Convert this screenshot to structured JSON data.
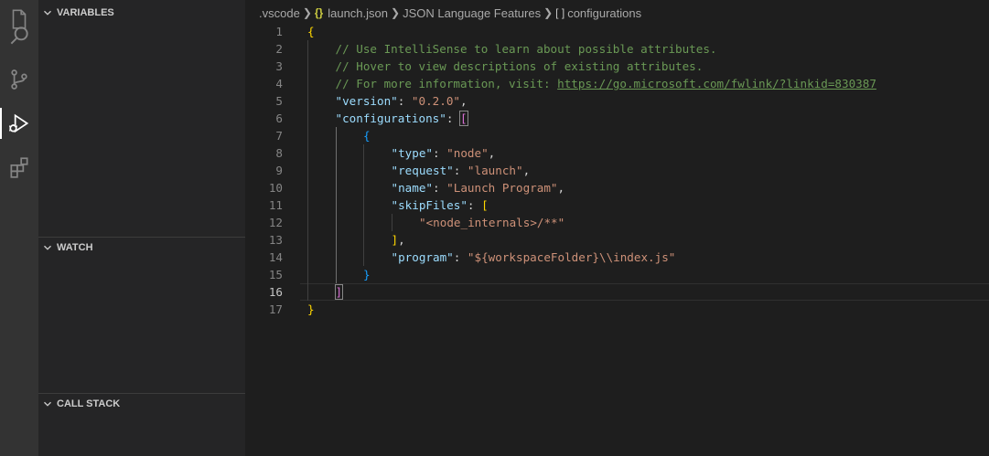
{
  "activity_bar": {
    "items": [
      {
        "icon": "explorer-icon"
      },
      {
        "icon": "search-icon"
      },
      {
        "icon": "source-control-icon"
      },
      {
        "icon": "run-debug-icon",
        "active": true
      },
      {
        "icon": "extensions-icon"
      }
    ]
  },
  "sidebar": {
    "variables_label": "VARIABLES",
    "watch_label": "WATCH",
    "call_stack_label": "CALL STACK"
  },
  "breadcrumb": {
    "folder": ".vscode",
    "file_icon": "{}",
    "file": "launch.json",
    "section": "JSON Language Features",
    "symbol_icon": "[ ]",
    "symbol": "configurations"
  },
  "editor": {
    "current_line": 16,
    "lines": [
      {
        "num": "1",
        "indent": 0,
        "tokens": [
          {
            "t": "{",
            "c": "c-brace1"
          }
        ]
      },
      {
        "num": "2",
        "indent": 1,
        "tokens": [
          {
            "t": "// Use IntelliSense to learn about possible attributes.",
            "c": "c-comment"
          }
        ]
      },
      {
        "num": "3",
        "indent": 1,
        "tokens": [
          {
            "t": "// Hover to view descriptions of existing attributes.",
            "c": "c-comment"
          }
        ]
      },
      {
        "num": "4",
        "indent": 1,
        "tokens": [
          {
            "t": "// For more information, visit: ",
            "c": "c-comment"
          },
          {
            "t": "https://go.microsoft.com/fwlink/?linkid=830387",
            "c": "c-link"
          }
        ]
      },
      {
        "num": "5",
        "indent": 1,
        "tokens": [
          {
            "t": "\"version\"",
            "c": "c-key"
          },
          {
            "t": ": ",
            "c": "c-punc"
          },
          {
            "t": "\"0.2.0\"",
            "c": "c-str"
          },
          {
            "t": ",",
            "c": "c-punc"
          }
        ]
      },
      {
        "num": "6",
        "indent": 1,
        "tokens": [
          {
            "t": "\"configurations\"",
            "c": "c-key"
          },
          {
            "t": ": ",
            "c": "c-punc"
          },
          {
            "t": "[",
            "c": "c-brace2 bracket-match"
          }
        ]
      },
      {
        "num": "7",
        "indent": 2,
        "tokens": [
          {
            "t": "{",
            "c": "c-brace3"
          }
        ]
      },
      {
        "num": "8",
        "indent": 3,
        "tokens": [
          {
            "t": "\"type\"",
            "c": "c-key"
          },
          {
            "t": ": ",
            "c": "c-punc"
          },
          {
            "t": "\"node\"",
            "c": "c-str"
          },
          {
            "t": ",",
            "c": "c-punc"
          }
        ]
      },
      {
        "num": "9",
        "indent": 3,
        "tokens": [
          {
            "t": "\"request\"",
            "c": "c-key"
          },
          {
            "t": ": ",
            "c": "c-punc"
          },
          {
            "t": "\"launch\"",
            "c": "c-str"
          },
          {
            "t": ",",
            "c": "c-punc"
          }
        ]
      },
      {
        "num": "10",
        "indent": 3,
        "tokens": [
          {
            "t": "\"name\"",
            "c": "c-key"
          },
          {
            "t": ": ",
            "c": "c-punc"
          },
          {
            "t": "\"Launch Program\"",
            "c": "c-str"
          },
          {
            "t": ",",
            "c": "c-punc"
          }
        ]
      },
      {
        "num": "11",
        "indent": 3,
        "tokens": [
          {
            "t": "\"skipFiles\"",
            "c": "c-key"
          },
          {
            "t": ": ",
            "c": "c-punc"
          },
          {
            "t": "[",
            "c": "c-brace1"
          }
        ]
      },
      {
        "num": "12",
        "indent": 4,
        "tokens": [
          {
            "t": "\"<node_internals>/**\"",
            "c": "c-str"
          }
        ]
      },
      {
        "num": "13",
        "indent": 3,
        "tokens": [
          {
            "t": "]",
            "c": "c-brace1"
          },
          {
            "t": ",",
            "c": "c-punc"
          }
        ]
      },
      {
        "num": "14",
        "indent": 3,
        "tokens": [
          {
            "t": "\"program\"",
            "c": "c-key"
          },
          {
            "t": ": ",
            "c": "c-punc"
          },
          {
            "t": "\"${workspaceFolder}\\\\index.js\"",
            "c": "c-str"
          }
        ]
      },
      {
        "num": "15",
        "indent": 2,
        "tokens": [
          {
            "t": "}",
            "c": "c-brace3"
          }
        ]
      },
      {
        "num": "16",
        "indent": 1,
        "tokens": [
          {
            "t": "]",
            "c": "c-brace2 bracket-match"
          }
        ]
      },
      {
        "num": "17",
        "indent": 0,
        "tokens": [
          {
            "t": "}",
            "c": "c-brace1"
          }
        ]
      }
    ]
  }
}
